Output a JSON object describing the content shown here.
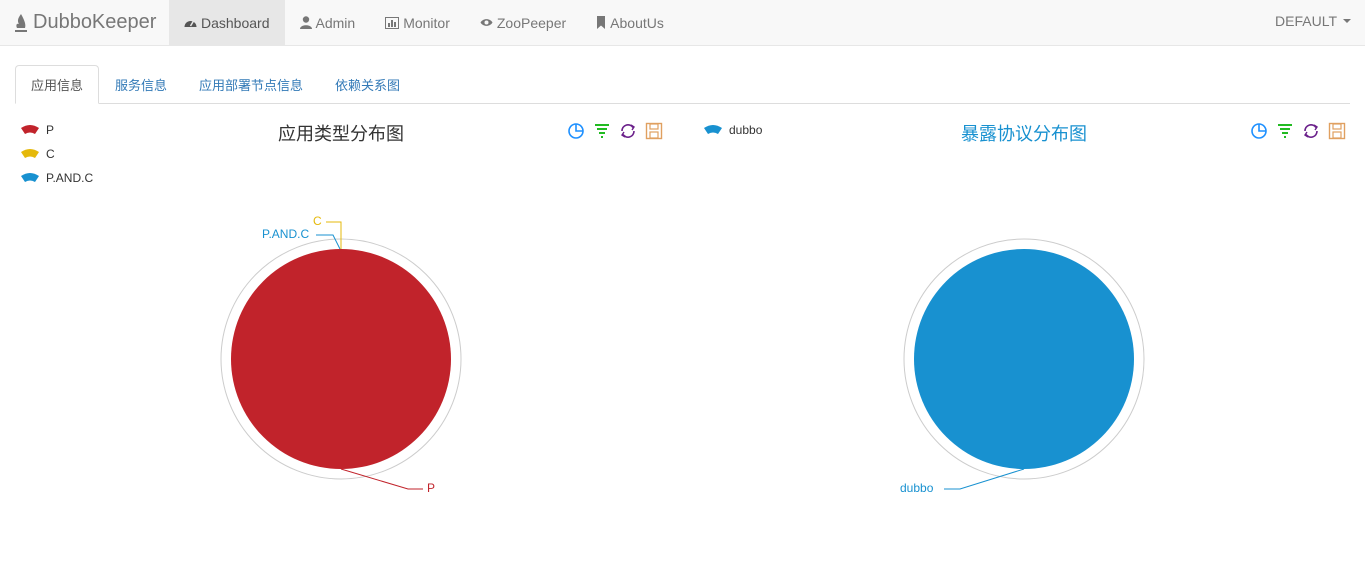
{
  "navbar": {
    "brand": "DubboKeeper",
    "items": [
      {
        "label": "Dashboard",
        "active": true,
        "icon": "dashboard-icon"
      },
      {
        "label": "Admin",
        "icon": "user-icon"
      },
      {
        "label": "Monitor",
        "icon": "stats-icon"
      },
      {
        "label": "ZooPeeper",
        "icon": "eye-icon"
      },
      {
        "label": "AboutUs",
        "icon": "bookmark-icon"
      }
    ],
    "environment": "DEFAULT"
  },
  "tabs": [
    "应用信息",
    "服务信息",
    "应用部署节点信息",
    "依赖关系图"
  ],
  "colors": {
    "p": "#c1232b",
    "c": "#e5b90b",
    "pandc": "#1891d0",
    "dubbo": "#1891d0"
  },
  "charts": [
    {
      "title": "应用类型分布图",
      "title_color": "#333333",
      "legend": [
        "P",
        "C",
        "P.AND.C"
      ],
      "labels": {
        "p": "P",
        "c": "C",
        "pandc": "P.AND.C"
      }
    },
    {
      "title": "暴露协议分布图",
      "title_color": "#1891d0",
      "legend": [
        "dubbo"
      ],
      "labels": {
        "dubbo": "dubbo"
      }
    }
  ],
  "chart_data": [
    {
      "type": "pie",
      "title": "应用类型分布图",
      "categories": [
        "P",
        "C",
        "P.AND.C"
      ],
      "values": [
        100,
        0,
        0
      ],
      "colors": [
        "#c1232b",
        "#e5b90b",
        "#1891d0"
      ],
      "legend_position": "top-left"
    },
    {
      "type": "pie",
      "title": "暴露协议分布图",
      "categories": [
        "dubbo"
      ],
      "values": [
        100
      ],
      "colors": [
        "#1891d0"
      ],
      "legend_position": "top-left"
    }
  ]
}
